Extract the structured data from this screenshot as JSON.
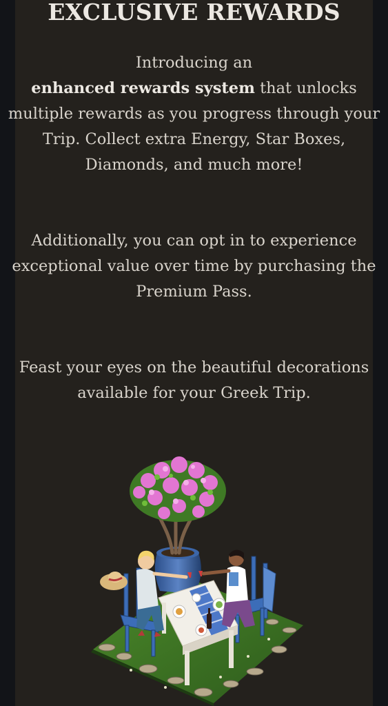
{
  "heading": "EXCLUSIVE REWARDS",
  "paragraph1": {
    "lead": "Introducing an ",
    "bold": "enhanced rewards system",
    "rest": " that unlocks multiple rewards as you progress through your Trip. Collect extra Energy, Star Boxes, Diamonds, and much more!"
  },
  "paragraph2": "Additionally, you can opt in to experience exceptional value over time by purchasing the Premium Pass.",
  "paragraph3": "Feast your eyes on the beautiful decorations available for your Greek Trip.",
  "colors": {
    "page_background": "#121418",
    "panel_background": "#24211d",
    "heading_text": "#ece8e2",
    "body_text": "#d9d4cc"
  },
  "illustration": {
    "icon": "greek-dinner-table-decoration-icon"
  }
}
